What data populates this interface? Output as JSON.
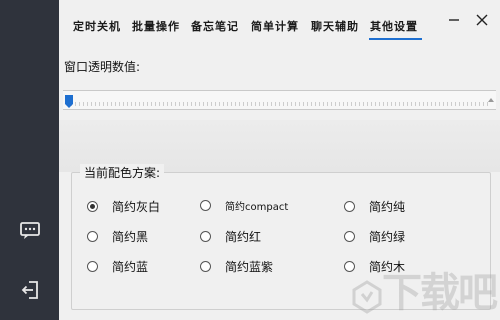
{
  "tabs": [
    {
      "label": "定时关机",
      "active": false
    },
    {
      "label": "批量操作",
      "active": false
    },
    {
      "label": "备忘笔记",
      "active": false
    },
    {
      "label": "简单计算",
      "active": false
    },
    {
      "label": "聊天辅助",
      "active": false
    },
    {
      "label": "其他设置",
      "active": true
    }
  ],
  "window": {
    "minimize_icon": "minimize-icon",
    "close_icon": "close-icon"
  },
  "sidebar": {
    "items": [
      {
        "icon": "chat-icon"
      },
      {
        "icon": "logout-icon"
      }
    ]
  },
  "transparency": {
    "label": "窗口透明数值:",
    "value_fraction": 0.0
  },
  "color_scheme": {
    "legend": "当前配色方案:",
    "options": [
      {
        "label": "简约灰白",
        "checked": true
      },
      {
        "label": "简约compact",
        "checked": false
      },
      {
        "label": "简约纯",
        "checked": false
      },
      {
        "label": "简约黑",
        "checked": false
      },
      {
        "label": "简约红",
        "checked": false
      },
      {
        "label": "简约绿",
        "checked": false
      },
      {
        "label": "简约蓝",
        "checked": false
      },
      {
        "label": "简约蓝紫",
        "checked": false
      },
      {
        "label": "简约木",
        "checked": false
      }
    ]
  },
  "colors": {
    "rail": "#2f333c",
    "accent": "#1e6fd0",
    "background": "#f0f0f0"
  },
  "watermark": {
    "text": "下载吧"
  }
}
